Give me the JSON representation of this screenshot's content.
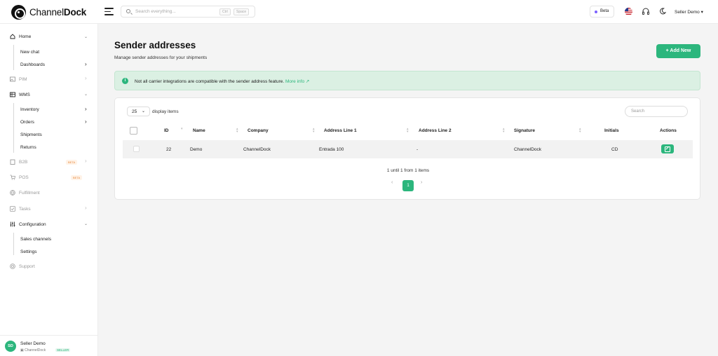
{
  "brand": {
    "name_light": "Channel",
    "name_bold": "Dock",
    "accent": "#2cb67d"
  },
  "topbar": {
    "search_placeholder": "Search everything...",
    "kbd_1": "Ctrl",
    "kbd_2": "Space",
    "beta_label": "Beta",
    "user_label": "Seller Demo"
  },
  "sidebar": {
    "home": "Home",
    "home_sub": [
      "New chat",
      "Dashboards"
    ],
    "pim": "PIM",
    "wms": "WMS",
    "wms_sub": [
      "Inventory",
      "Orders",
      "Shipments",
      "Returns"
    ],
    "b2b": "B2B",
    "pos": "POS",
    "beta_tag": "BETA",
    "fulfillment": "Fulfillment",
    "tasks": "Tasks",
    "configuration": "Configuration",
    "config_sub": [
      "Sales channels",
      "Settings"
    ],
    "support": "Support",
    "user": {
      "initials": "SD",
      "name": "Seller Demo",
      "company": "ChannelDock",
      "role": "SELLER"
    }
  },
  "page": {
    "title": "Sender addresses",
    "subtitle": "Manage sender addresses for your shipments",
    "add_button": "+ Add New"
  },
  "alert": {
    "message": "Not all carrier integrations are compatible with the sender address feature.",
    "link": "More info"
  },
  "table": {
    "per_page": "25",
    "per_page_label": "display items",
    "search_placeholder": "Search",
    "columns": {
      "id": "ID",
      "name": "Name",
      "company": "Company",
      "address1": "Address Line 1",
      "address2": "Address Line 2",
      "signature": "Signature",
      "initials": "Initials",
      "actions": "Actions"
    },
    "rows": [
      {
        "id": "22",
        "name": "Demo",
        "company": "ChannelDock",
        "address1": "Entrada 100",
        "address2": "-",
        "signature": "ChannelDock",
        "initials": "CD"
      }
    ],
    "count_text": "1 until 1 from 1 items",
    "current_page": "1",
    "prev": "‹",
    "next": "›"
  }
}
